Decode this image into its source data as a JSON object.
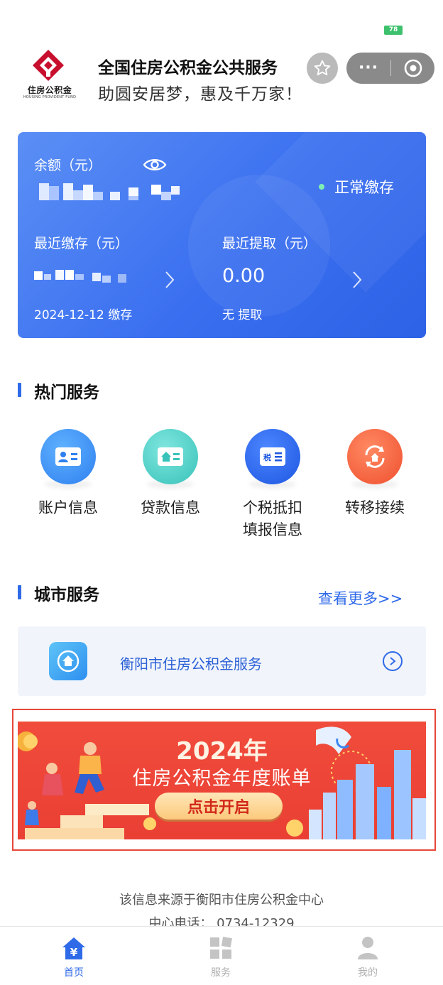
{
  "status": {
    "battery": "78"
  },
  "header": {
    "logo_cn": "住房公积金",
    "logo_en": "HOUSING PROVIDENT FUND",
    "title": "全国住房公积金公共服务",
    "slogan": "助圆安居梦，惠及千万家！",
    "icons": [
      "star-icon",
      "more-dots-icon",
      "target-icon"
    ]
  },
  "account": {
    "balance_label": "余额（元）",
    "status": "正常缴存",
    "recent_deposit_label": "最近缴存（元）",
    "recent_withdraw_label": "最近提取（元）",
    "recent_withdraw_amount": "0.00",
    "deposit_date_text": "2024-12-12 缴存",
    "withdraw_date_text": "无 提取",
    "colors": {
      "card": "#3a6ff0",
      "status_dot": "#7ff0b3"
    }
  },
  "hot_services": {
    "title": "热门服务",
    "items": [
      {
        "label": "账户信息",
        "color": "#3a8ff3"
      },
      {
        "label": "贷款信息",
        "color": "#3cc9c0"
      },
      {
        "label": "个税抵扣填报信息",
        "label_line1": "个税抵扣",
        "label_line2": "填报信息",
        "color": "#2563e8"
      },
      {
        "label": "转移接续",
        "color": "#f35c3c"
      }
    ]
  },
  "city_services": {
    "title": "城市服务",
    "more": "查看更多>>",
    "item": "衡阳市住房公积金服务"
  },
  "banner": {
    "year": "2024年",
    "title": "住房公积金年度账单",
    "button": "点击开启"
  },
  "footer": {
    "source": "该信息来源于衡阳市住房公积金中心",
    "phone": "中心电话： 0734-12329"
  },
  "tabs": [
    {
      "label": "首页",
      "active": true
    },
    {
      "label": "服务",
      "active": false
    },
    {
      "label": "我的",
      "active": false
    }
  ]
}
